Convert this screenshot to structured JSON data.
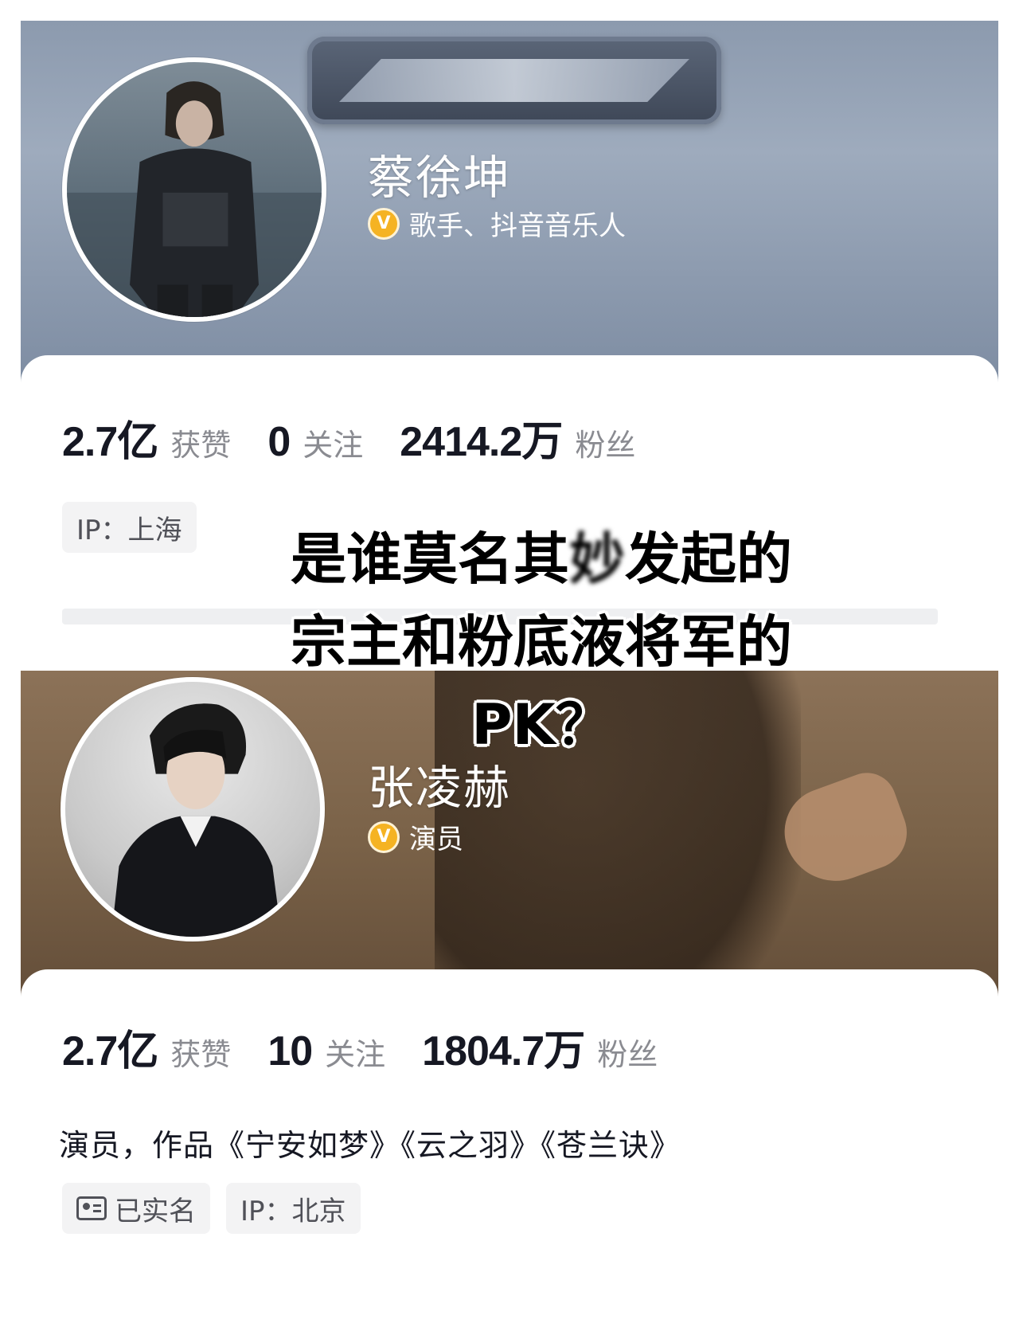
{
  "profiles": [
    {
      "name": "蔡徐坤",
      "verified_title": "歌手、抖音音乐人",
      "verified_icon": "verified-v-icon",
      "stats": [
        {
          "value": "2.7亿",
          "label": "获赞"
        },
        {
          "value": "0",
          "label": "关注"
        },
        {
          "value": "2414.2万",
          "label": "粉丝"
        }
      ],
      "tags": [
        {
          "text": "IP：上海"
        }
      ]
    },
    {
      "name": "张凌赫",
      "verified_title": "演员",
      "verified_icon": "verified-v-icon",
      "stats": [
        {
          "value": "2.7亿",
          "label": "获赞"
        },
        {
          "value": "10",
          "label": "关注"
        },
        {
          "value": "1804.7万",
          "label": "粉丝"
        }
      ],
      "bio": "演员，作品《宁安如梦》《云之羽》《苍兰诀》",
      "tags": [
        {
          "text": "已实名",
          "icon": "id-card-icon"
        },
        {
          "text": "IP：北京"
        }
      ]
    }
  ],
  "caption": {
    "line1_start": "是谁莫名其",
    "line1_blurred": "妙",
    "line1_end": "发起的",
    "line2": "宗主和粉底液将军的",
    "line3": "PK？"
  },
  "colors": {
    "badge": "#f5b323",
    "text_primary": "#161823",
    "text_secondary": "#8a8b91",
    "tag_bg": "#f3f3f4"
  }
}
